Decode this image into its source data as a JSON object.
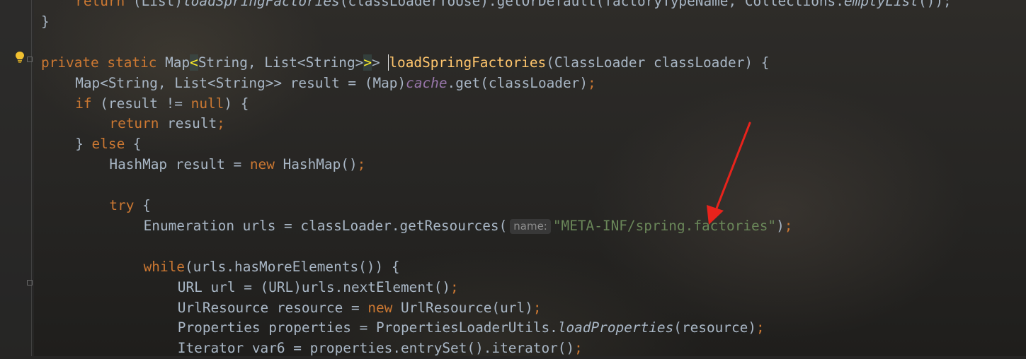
{
  "editor": {
    "lines": [
      {
        "indent": 4,
        "tokens": [
          {
            "t": "return ",
            "c": "kw"
          },
          {
            "t": "(List)",
            "c": ""
          },
          {
            "t": "loadSpringFactories",
            "c": "ital"
          },
          {
            "t": "(classLoaderToUse).getOrDefault(factoryTypeName, Collections.",
            "c": ""
          },
          {
            "t": "emptyList",
            "c": "ital"
          },
          {
            "t": "());",
            "c": ""
          }
        ]
      },
      {
        "indent": 0,
        "tokens": [
          {
            "t": "}",
            "c": ""
          }
        ]
      },
      {
        "indent": 0,
        "tokens": []
      },
      {
        "indent": 0,
        "tokens": [
          {
            "t": "private static ",
            "c": "kw"
          },
          {
            "t": "Map",
            "c": ""
          },
          {
            "t": "<",
            "c": "match"
          },
          {
            "t": "String, List<String>",
            "c": ""
          },
          {
            "t": ">",
            "c": "match"
          },
          {
            "t": "> ",
            "c": ""
          },
          {
            "t": "",
            "c": "caret"
          },
          {
            "t": "loadSpringFactories",
            "c": "fn"
          },
          {
            "t": "(ClassLoader classLoader) {",
            "c": ""
          }
        ]
      },
      {
        "indent": 4,
        "tokens": [
          {
            "t": "Map<String, List<String>> result = (Map)",
            "c": ""
          },
          {
            "t": "cache",
            "c": "field"
          },
          {
            "t": ".get(classLoader)",
            "c": ""
          },
          {
            "t": ";",
            "c": "kw"
          }
        ]
      },
      {
        "indent": 4,
        "tokens": [
          {
            "t": "if ",
            "c": "kw"
          },
          {
            "t": "(result != ",
            "c": ""
          },
          {
            "t": "null",
            "c": "kw"
          },
          {
            "t": ") {",
            "c": ""
          }
        ]
      },
      {
        "indent": 8,
        "tokens": [
          {
            "t": "return ",
            "c": "kw"
          },
          {
            "t": "result",
            "c": ""
          },
          {
            "t": ";",
            "c": "kw"
          }
        ]
      },
      {
        "indent": 4,
        "tokens": [
          {
            "t": "} ",
            "c": ""
          },
          {
            "t": "else ",
            "c": "kw"
          },
          {
            "t": "{",
            "c": ""
          }
        ]
      },
      {
        "indent": 8,
        "tokens": [
          {
            "t": "HashMap result = ",
            "c": ""
          },
          {
            "t": "new ",
            "c": "kw"
          },
          {
            "t": "HashMap()",
            "c": ""
          },
          {
            "t": ";",
            "c": "kw"
          }
        ]
      },
      {
        "indent": 0,
        "tokens": []
      },
      {
        "indent": 8,
        "tokens": [
          {
            "t": "try ",
            "c": "kw"
          },
          {
            "t": "{",
            "c": ""
          }
        ]
      },
      {
        "indent": 12,
        "tokens": [
          {
            "t": "Enumeration urls = classLoader.getResources(",
            "c": ""
          },
          {
            "t": "name:",
            "c": "hint"
          },
          {
            "t": "\"META-INF/spring.factories\"",
            "c": "str"
          },
          {
            "t": ")",
            "c": ""
          },
          {
            "t": ";",
            "c": "kw"
          }
        ]
      },
      {
        "indent": 0,
        "tokens": []
      },
      {
        "indent": 12,
        "tokens": [
          {
            "t": "while",
            "c": "kw"
          },
          {
            "t": "(urls.hasMoreElements()) {",
            "c": ""
          }
        ]
      },
      {
        "indent": 16,
        "tokens": [
          {
            "t": "URL url = (URL)urls.nextElement()",
            "c": ""
          },
          {
            "t": ";",
            "c": "kw"
          }
        ]
      },
      {
        "indent": 16,
        "tokens": [
          {
            "t": "UrlResource resource = ",
            "c": ""
          },
          {
            "t": "new ",
            "c": "kw"
          },
          {
            "t": "UrlResource(url)",
            "c": ""
          },
          {
            "t": ";",
            "c": "kw"
          }
        ]
      },
      {
        "indent": 16,
        "tokens": [
          {
            "t": "Properties properties = PropertiesLoaderUtils.",
            "c": ""
          },
          {
            "t": "loadProperties",
            "c": "ital"
          },
          {
            "t": "(resource)",
            "c": ""
          },
          {
            "t": ";",
            "c": "kw"
          }
        ]
      },
      {
        "indent": 16,
        "tokens": [
          {
            "t": "Iterator var6 = properties.entrySet().iterator()",
            "c": ""
          },
          {
            "t": ";",
            "c": "kw"
          }
        ]
      }
    ]
  },
  "gutter": {
    "intention_icon": "lightbulb-icon"
  },
  "colors": {
    "keyword": "#cc7832",
    "string": "#6a8759",
    "method_declaration": "#ffc66d",
    "field": "#9876aa",
    "default_text": "#a9b7c6",
    "annotation_arrow": "#e8231c"
  }
}
